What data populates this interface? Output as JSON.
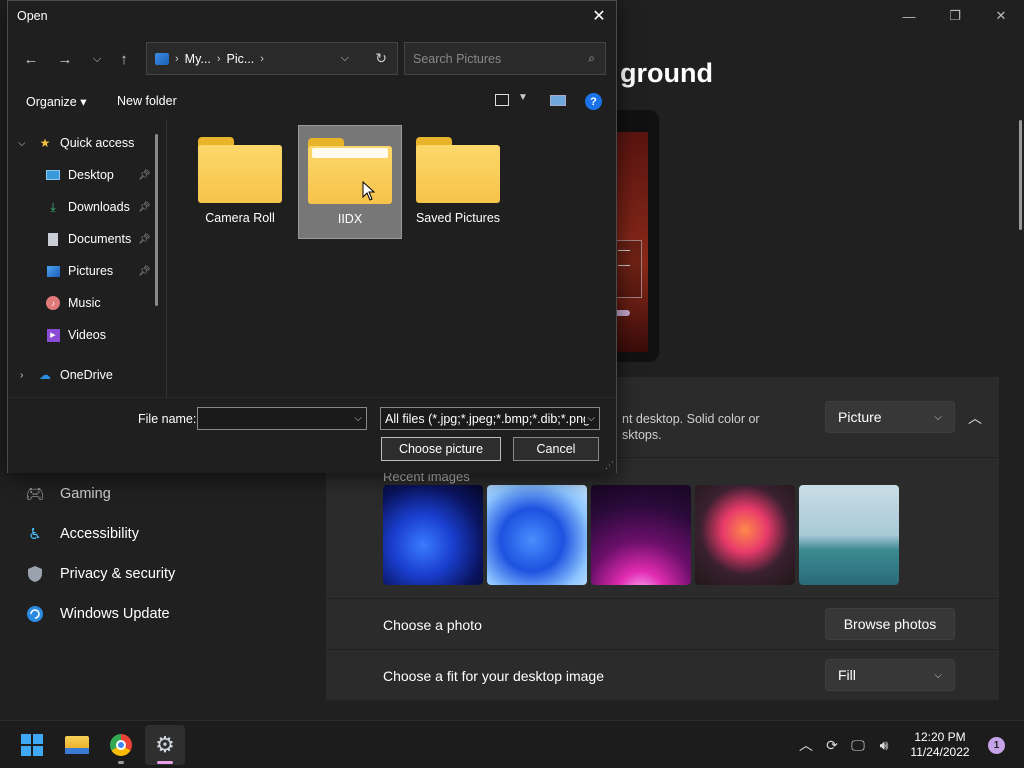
{
  "settings": {
    "title_partial": "ground",
    "background_desc_line1": "nt desktop. Solid color or",
    "background_desc_line2": "sktops.",
    "background_type": "Picture",
    "recent_images_label": "Recent images",
    "choose_photo_label": "Choose a photo",
    "browse_photos_label": "Browse photos",
    "fit_label": "Choose a fit for your desktop image",
    "fit_value": "Fill",
    "nav": [
      {
        "label": "Gaming",
        "icon": "gamepad-icon"
      },
      {
        "label": "Accessibility",
        "icon": "accessibility-icon"
      },
      {
        "label": "Privacy & security",
        "icon": "shield-icon"
      },
      {
        "label": "Windows Update",
        "icon": "refresh-icon"
      }
    ],
    "window_controls": {
      "minimize": "—",
      "maximize": "❐",
      "close": "✕"
    }
  },
  "dialog": {
    "title": "Open",
    "breadcrumb": [
      "My...",
      "Pic..."
    ],
    "search_placeholder": "Search Pictures",
    "toolbar": {
      "organize": "Organize ▾",
      "new_folder": "New folder",
      "help": "?"
    },
    "tree": [
      {
        "label": "Quick access",
        "icon": "star-icon",
        "expanded": true
      },
      {
        "label": "Desktop",
        "icon": "desktop-icon",
        "pinned": true
      },
      {
        "label": "Downloads",
        "icon": "download-icon",
        "pinned": true
      },
      {
        "label": "Documents",
        "icon": "document-icon",
        "pinned": true
      },
      {
        "label": "Pictures",
        "icon": "pictures-icon",
        "pinned": true
      },
      {
        "label": "Music",
        "icon": "music-icon",
        "pinned": false
      },
      {
        "label": "Videos",
        "icon": "video-icon",
        "pinned": false
      },
      {
        "label": "OneDrive",
        "icon": "cloud-icon",
        "expanded": false
      }
    ],
    "folders": [
      {
        "name": "Camera Roll",
        "selected": false
      },
      {
        "name": "IIDX",
        "selected": true
      },
      {
        "name": "Saved Pictures",
        "selected": false
      }
    ],
    "file_name_label": "File name:",
    "file_name_value": "",
    "file_type": "All files (*.jpg;*.jpeg;*.bmp;*.dib;*.png",
    "choose_button": "Choose picture",
    "cancel_button": "Cancel"
  },
  "taskbar": {
    "apps": [
      {
        "name": "start-button",
        "active": false
      },
      {
        "name": "file-explorer",
        "active": false
      },
      {
        "name": "chrome",
        "active": false
      },
      {
        "name": "settings",
        "active": true
      }
    ],
    "time": "12:20 PM",
    "date": "11/24/2022",
    "notification_count": "1"
  }
}
